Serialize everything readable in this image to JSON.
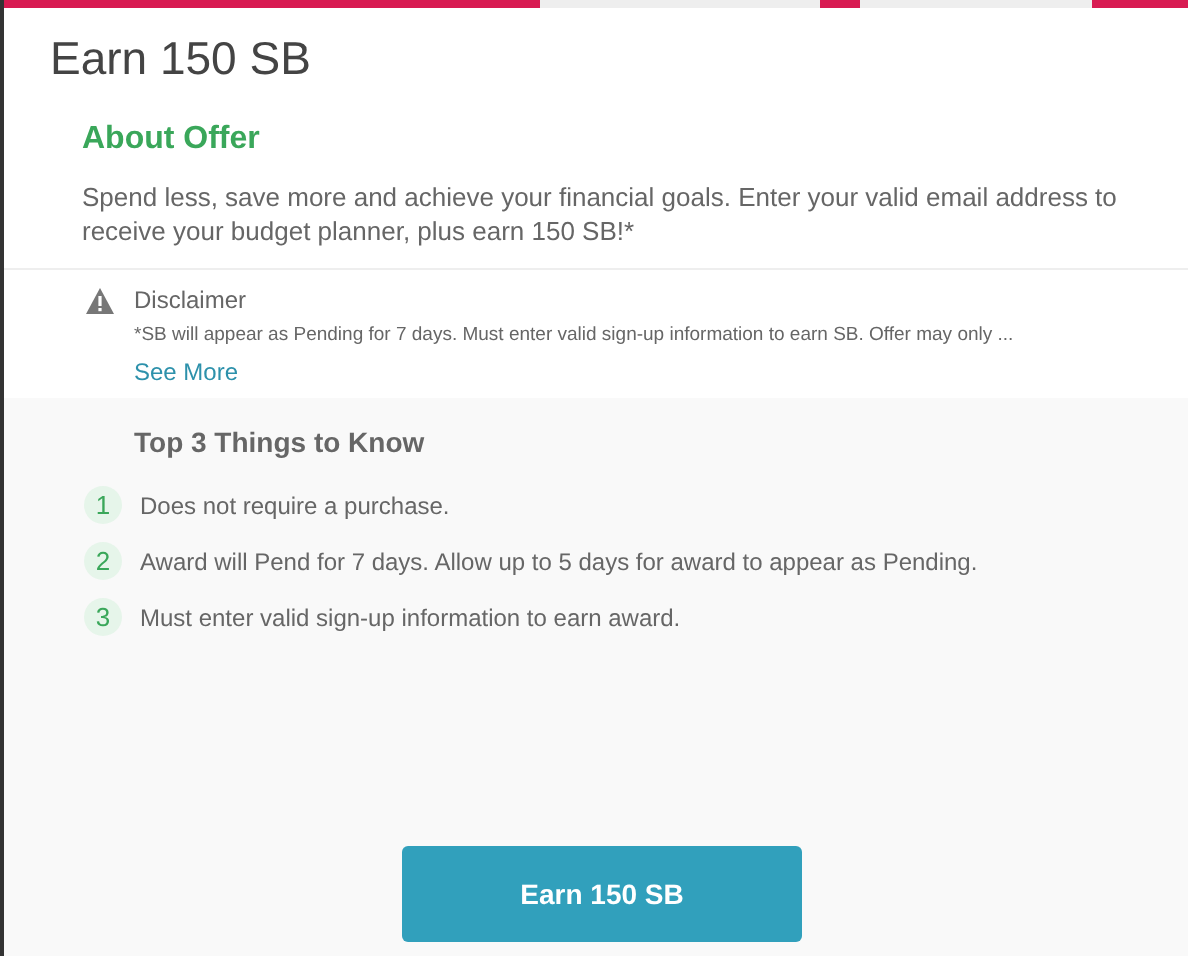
{
  "title": "Earn 150 SB",
  "about": {
    "heading": "About Offer",
    "text": "Spend less, save more and achieve your financial goals. Enter your valid email address to receive your budget planner, plus earn 150 SB!*"
  },
  "disclaimer": {
    "label": "Disclaimer",
    "text": "*SB will appear as Pending for 7 days. Must enter valid sign-up information to earn SB. Offer may only ...",
    "link": "See More"
  },
  "things": {
    "heading": "Top 3 Things to Know",
    "items": [
      {
        "number": "1",
        "text": "Does not require a purchase."
      },
      {
        "number": "2",
        "text": "Award will Pend for 7 days. Allow up to 5 days for award to appear as Pending."
      },
      {
        "number": "3",
        "text": "Must enter valid sign-up information to earn award."
      }
    ]
  },
  "button": "Earn 150 SB"
}
